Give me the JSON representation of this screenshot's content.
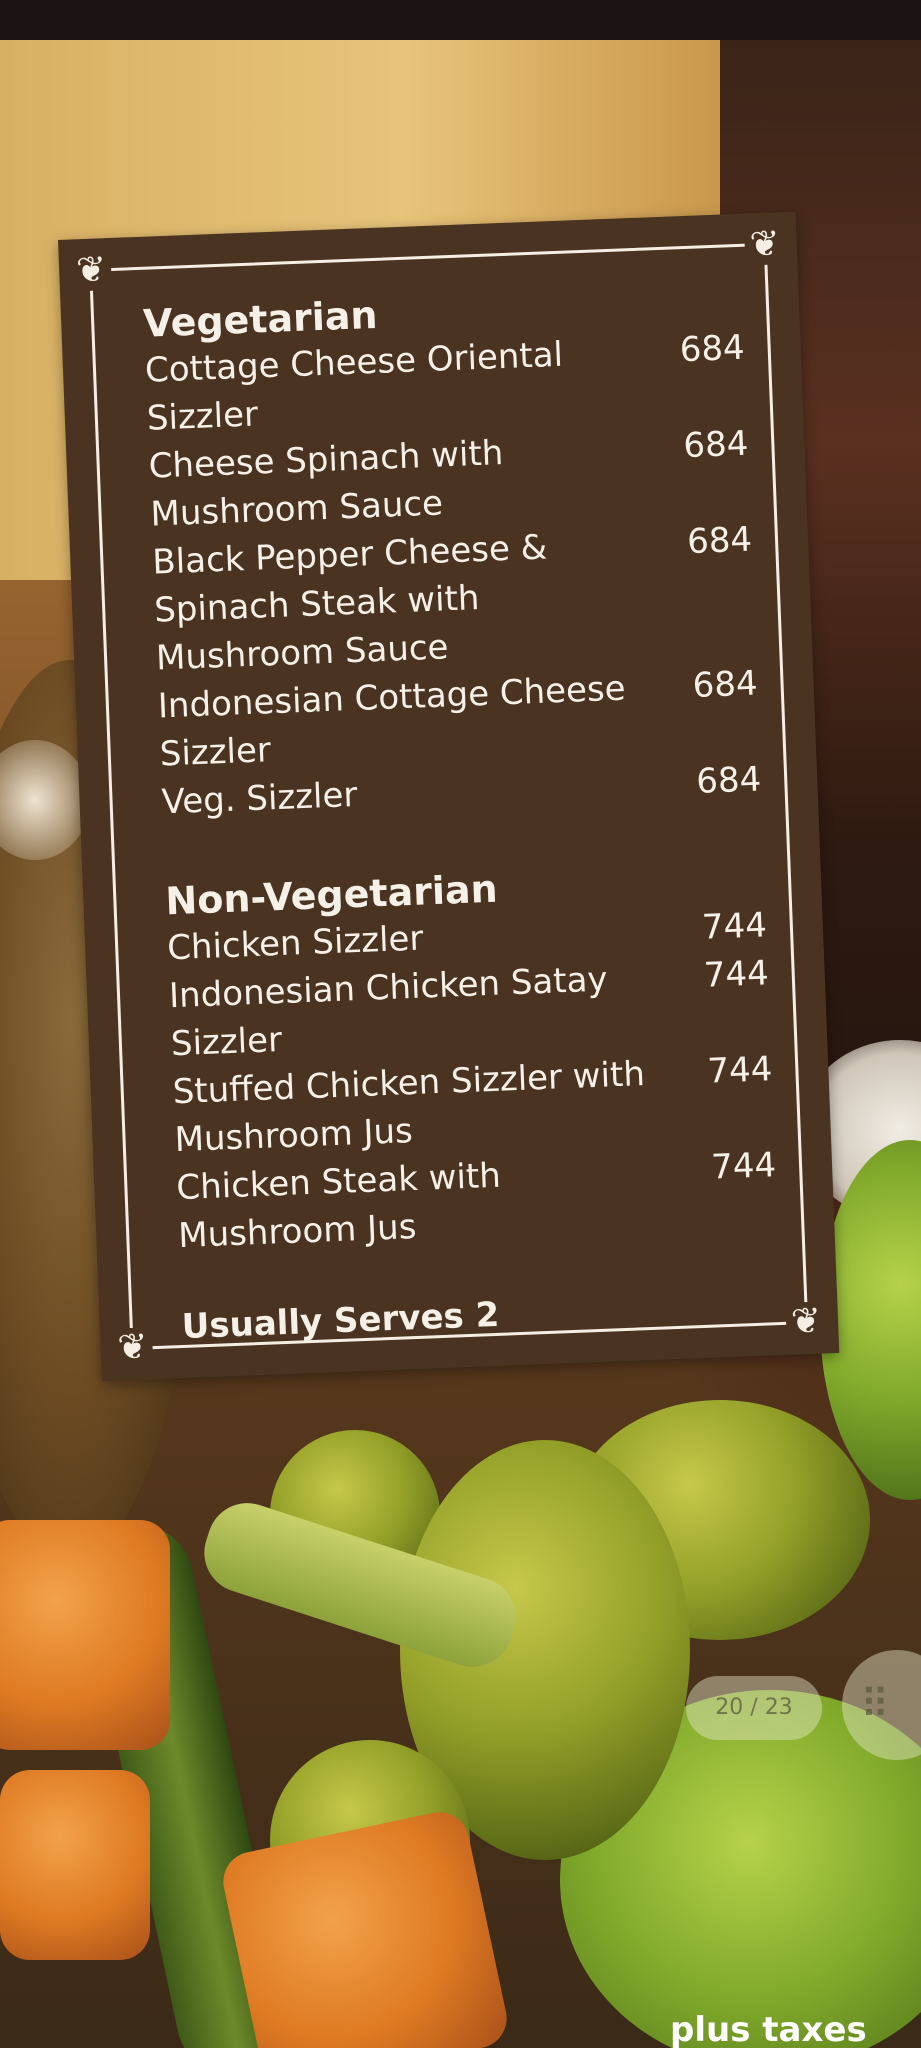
{
  "menu": {
    "vegetarian": {
      "title": "Vegetarian",
      "items": [
        {
          "name": "Cottage Cheese Oriental Sizzler",
          "price": "684"
        },
        {
          "name": "Cheese Spinach with Mushroom Sauce",
          "price": "684"
        },
        {
          "name": "Black Pepper Cheese & Spinach Steak with Mushroom Sauce",
          "price": "684"
        },
        {
          "name": "Indonesian Cottage Cheese Sizzler",
          "price": "684"
        },
        {
          "name": "Veg. Sizzler",
          "price": "684"
        }
      ]
    },
    "non_vegetarian": {
      "title": "Non-Vegetarian",
      "items": [
        {
          "name": "Chicken Sizzler",
          "price": "744"
        },
        {
          "name": "Indonesian Chicken Satay Sizzler",
          "price": "744"
        },
        {
          "name": "Stuffed Chicken Sizzler with Mushroom Jus",
          "price": "744"
        },
        {
          "name": "Chicken Steak with Mushroom Jus",
          "price": "744"
        }
      ]
    },
    "serves_note": "Usually Serves 2"
  },
  "viewer": {
    "page_indicator": "20 / 23",
    "grid_icon": "grid-icon"
  },
  "footer": {
    "note": "plus taxes"
  },
  "colors": {
    "card_background": "#4a3421",
    "card_text": "#f6f1e8"
  }
}
